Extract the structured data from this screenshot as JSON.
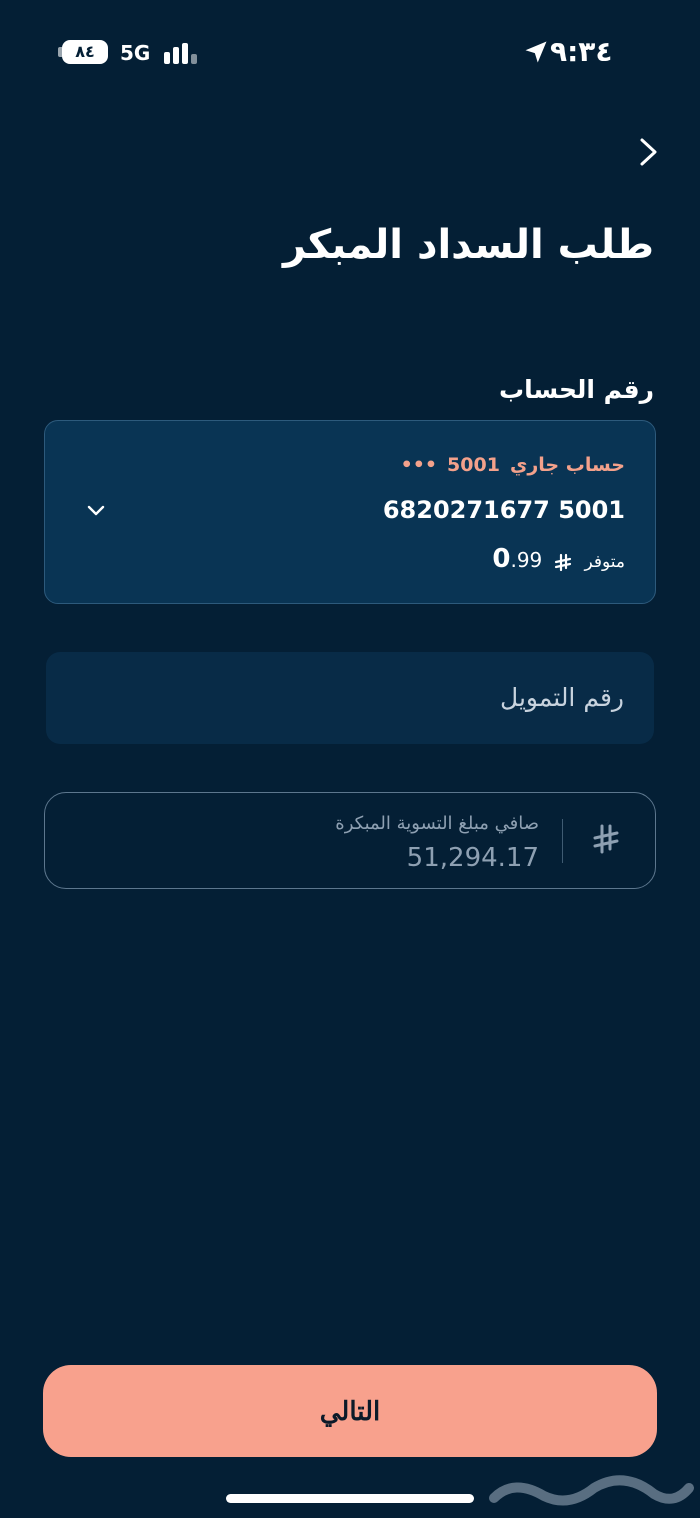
{
  "status_bar": {
    "battery": "٨٤",
    "network": "5G",
    "time": "٩:٣٤"
  },
  "header": {
    "title": "طلب السداد المبكر"
  },
  "account_section": {
    "label": "رقم الحساب",
    "account_type": "حساب جاري",
    "account_suffix": "5001",
    "mask": "•••",
    "account_number": "6820271677 5001",
    "balance_int": "0",
    "balance_dec": ".99",
    "available_label": "متوفر"
  },
  "financing": {
    "placeholder": "رقم التمويل"
  },
  "settlement": {
    "label": "صافي مبلغ التسوية المبكرة",
    "amount": "51,294.17"
  },
  "actions": {
    "next_label": "التالي"
  },
  "colors": {
    "background": "#041f35",
    "card": "#093454",
    "accent": "#f8a18d",
    "account_type": "#f3a18b"
  },
  "icons": {
    "back": "chevron-right-icon",
    "dropdown": "chevron-down-icon",
    "currency": "riyal-icon",
    "location": "location-arrow-icon"
  }
}
